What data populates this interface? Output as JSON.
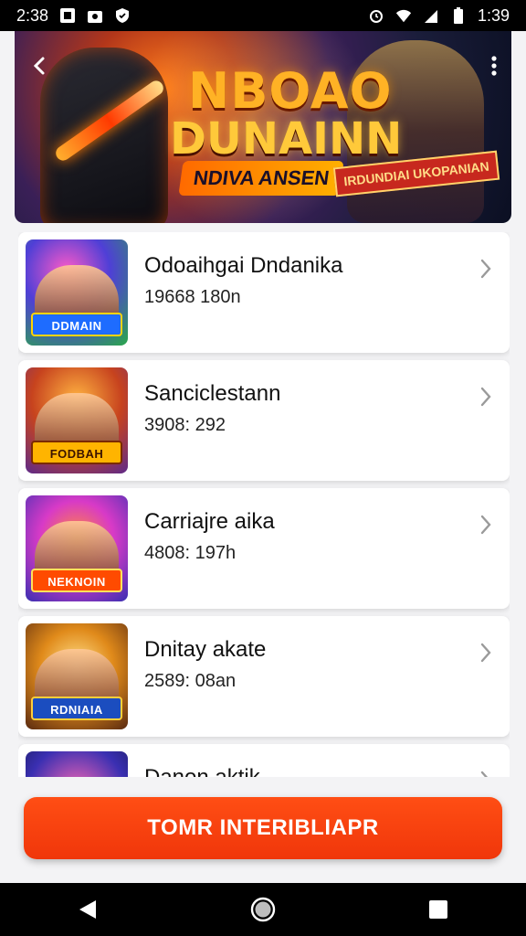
{
  "status_bar": {
    "time_left": "2:38",
    "time_right": "1:39"
  },
  "hero": {
    "title_line1": "NBOAO",
    "title_line2": "DUNAINN",
    "subtitle": "NDIVA ANSEN",
    "badge": "IRDUNDIAI UKOPANIAN"
  },
  "games": [
    {
      "title": "Odoaihgai Dndanika",
      "meta": "19668 180n",
      "logo": "DDMAIN"
    },
    {
      "title": "Sanciclestann",
      "meta": "3908: 292",
      "logo": "FODBAH"
    },
    {
      "title": "Carriajre aika",
      "meta": "4808: 197h",
      "logo": "NEKNOIN"
    },
    {
      "title": "Dnitay akate",
      "meta": "2589: 08an",
      "logo": "RDNIAIA"
    },
    {
      "title": "Danon aktik",
      "meta": "",
      "logo": ""
    }
  ],
  "cta": {
    "label": "TOMR INTERIBLIAPR"
  },
  "icons": {
    "back": "back-arrow-icon",
    "menu": "more-vertical-icon",
    "chevron": "chevron-right-icon",
    "nav_back": "nav-back-icon",
    "nav_home": "nav-home-icon",
    "nav_recents": "nav-recents-icon"
  },
  "colors": {
    "accent": "#f0360a",
    "status_bar": "#000000",
    "background": "#f3f3f5"
  }
}
